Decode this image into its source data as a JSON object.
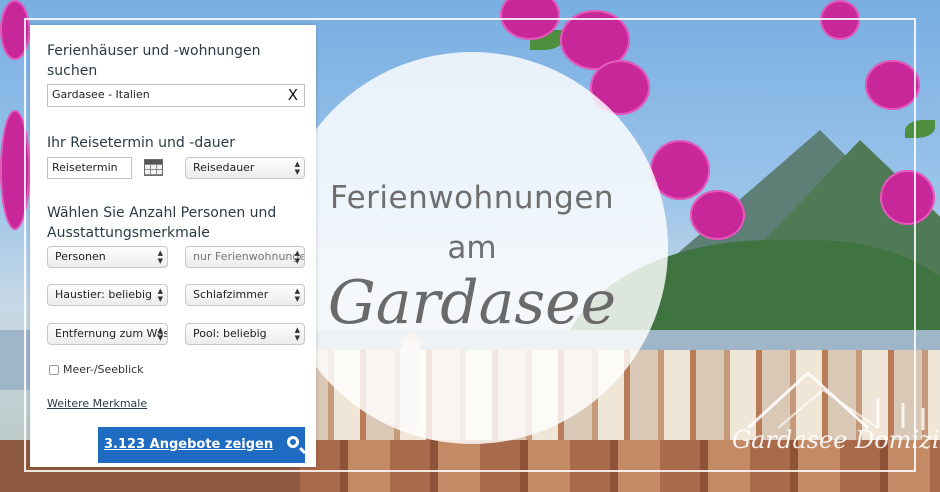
{
  "search_panel": {
    "destination_heading": "Ferienhäuser und -wohnungen suchen",
    "destination_value": "Gardasee - Italien",
    "clear_label": "X",
    "date_heading": "Ihr Reisetermin und -dauer",
    "date_placeholder": "Reisetermin",
    "duration_select": "Reisedauer",
    "persons_heading": "Wählen Sie Anzahl Personen und Ausstattungsmerkmale",
    "persons_select": "Personen",
    "type_select": "nur Ferienwohnungen",
    "pets_select": "Haustier: beliebig",
    "bedrooms_select": "Schlafzimmer",
    "distance_select": "Entfernung zum Wasser",
    "pool_select": "Pool: beliebig",
    "sea_view_label": "Meer-/Seeblick",
    "more_features_link": "Weitere Merkmale",
    "cta_label": "3.123 Angebote zeigen"
  },
  "banner": {
    "line1": "Ferienwohnungen",
    "line2": "am",
    "line3": "Gardasee",
    "brand": "Gardasee Domizil"
  },
  "colors": {
    "accent": "#1e6bc1",
    "flower": "#c8279a"
  }
}
